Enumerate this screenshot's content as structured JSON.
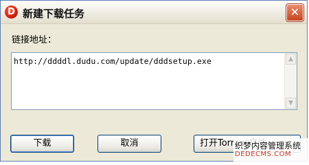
{
  "window": {
    "title": "新建下载任务",
    "logo_text": "D",
    "close_symbol": "✕"
  },
  "form": {
    "address_label": "链接地址：",
    "url_value": "http://ddddl.dudu.com/update/dddsetup.exe"
  },
  "buttons": {
    "download": "下载",
    "cancel": "取消",
    "open_torrent": "打开Torrent文件"
  },
  "watermark": {
    "line1": "织梦内容管理系统",
    "line2": "DEDECMS.COM"
  },
  "icons": {
    "logo": "dudu-logo-icon",
    "close": "close-icon",
    "scroll_up": "chevron-up-icon",
    "scroll_down": "chevron-down-icon"
  },
  "colors": {
    "window_border": "#5c7fb8",
    "dialog_bg": "#ece9d8",
    "close_button": "#c4451f",
    "logo_red": "#c8170b",
    "button_border": "#003c74"
  }
}
